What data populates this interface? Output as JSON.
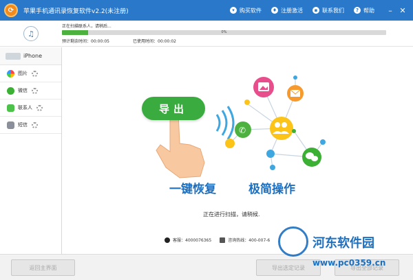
{
  "titlebar": {
    "app_title": "苹果手机通讯录恢复软件v2.2(未注册)",
    "links": [
      {
        "label": "购买软件",
        "icon": "cart-icon"
      },
      {
        "label": "注册激活",
        "icon": "key-icon"
      },
      {
        "label": "联系我们",
        "icon": "contact-icon"
      },
      {
        "label": "帮助",
        "icon": "help-icon"
      }
    ],
    "minimize_glyph": "–",
    "close_glyph": "✕"
  },
  "progress": {
    "status_text": "正在扫描联系人，请稍后...",
    "percent_label": "0%",
    "fill_fraction": 0.08,
    "remaining_label": "预计剩余时间：00:00:05",
    "used_label": "已使用时间：00:00:02",
    "fill_color": "#4cb13f"
  },
  "sidebar": {
    "device_name": "iPhone",
    "items": [
      {
        "label": "图片",
        "icon": "photos-icon",
        "color": "#f07a3a"
      },
      {
        "label": "微信",
        "icon": "wechat-icon",
        "color": "#3cb034"
      },
      {
        "label": "联系人",
        "icon": "messages-icon",
        "color": "#4cc24a"
      },
      {
        "label": "短信",
        "icon": "contacts-card-icon",
        "color": "#8a8f99"
      }
    ]
  },
  "main": {
    "export_label": "导出",
    "slogan_left": "一键恢复",
    "slogan_right": "极简操作",
    "scanning_text": "正在进行扫描，请稍候.",
    "support_qq": "客服：4000076365",
    "support_hotline": "咨询热线：400-007-6"
  },
  "bottom": {
    "back_label": "返回主界面",
    "export_records_label": "导出选定记录",
    "export_all_label": "导出全部记录"
  },
  "watermark": {
    "site_name": "河东软件园",
    "url": "www.pc0359.cn"
  },
  "colors": {
    "titlebar": "#2a78c9",
    "accent_blue": "#1d6fc0",
    "green": "#3aab3e"
  }
}
